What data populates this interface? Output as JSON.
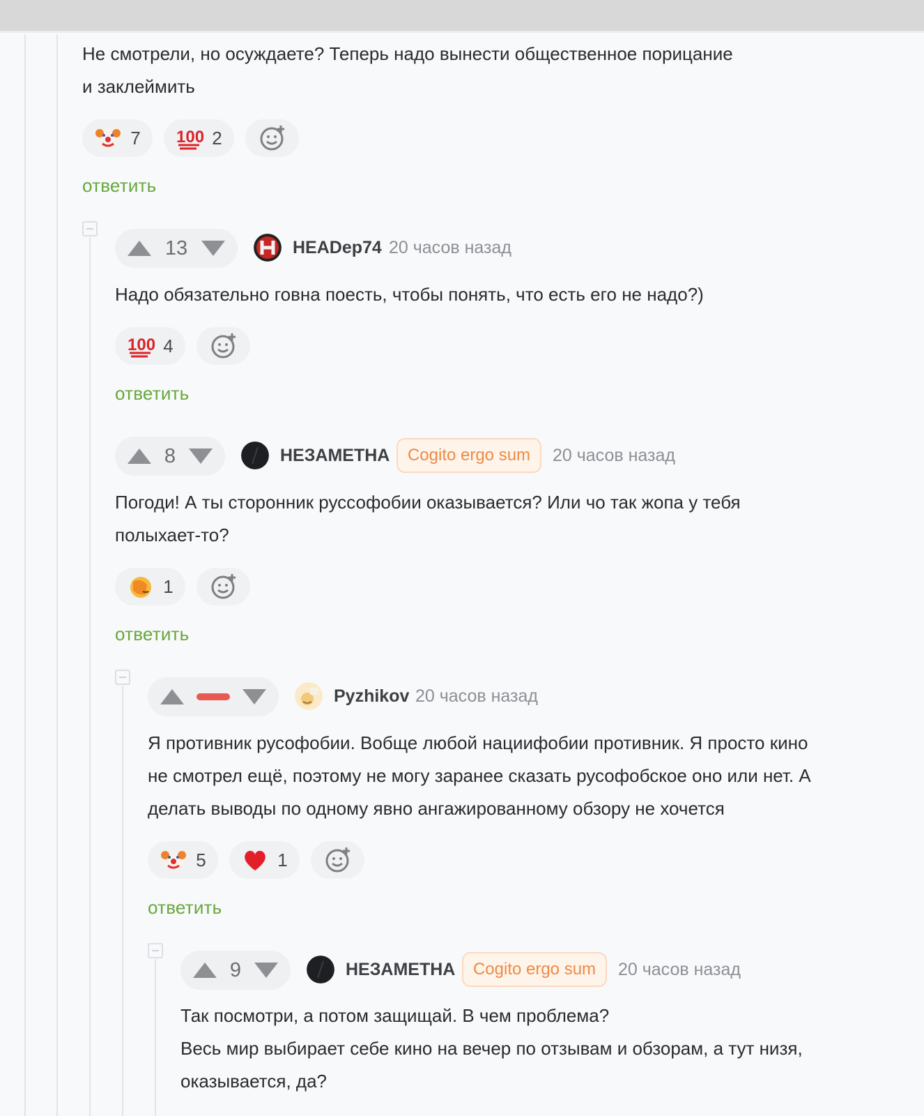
{
  "comments": [
    {
      "text_lines": [
        "Не смотрели, но осуждаете? Теперь надо вынести общественное порицание",
        "и заклеймить"
      ],
      "reactions": [
        {
          "icon": "clown-face-icon",
          "count": "7"
        },
        {
          "icon": "hundred-points-icon",
          "count": "2"
        }
      ],
      "reply_label": "ответить"
    },
    {
      "vote_count": "13",
      "username": "HEADep74",
      "time": "20 часов назад",
      "text_lines": [
        "Надо обязательно говна поесть, чтобы понять, что есть его не надо?)"
      ],
      "reactions": [
        {
          "icon": "hundred-points-icon",
          "count": "4"
        }
      ],
      "reply_label": "ответить"
    },
    {
      "vote_count": "8",
      "username": "НЕЗАМЕТНА",
      "badge": "Cogito ergo sum",
      "time": "20 часов назад",
      "text_lines": [
        "Погоди! А ты сторонник руссофобии оказывается? Или чо так жопа у тебя",
        "полыхает-то?"
      ],
      "reactions": [
        {
          "icon": "facepalm-icon",
          "count": "1"
        }
      ],
      "reply_label": "ответить"
    },
    {
      "username": "Pyzhikov",
      "time": "20 часов назад",
      "text_lines": [
        "Я противник русофобии. Вобще любой нациифобии противник. Я просто кино",
        "не смотрел ещё, поэтому не могу заранее сказать русофобское оно или нет. А",
        "делать выводы по одному явно ангажированному обзору не хочется"
      ],
      "reactions": [
        {
          "icon": "clown-face-icon",
          "count": "5"
        },
        {
          "icon": "red-heart-icon",
          "count": "1"
        }
      ],
      "reply_label": "ответить"
    },
    {
      "vote_count": "9",
      "username": "НЕЗАМЕТНА",
      "badge": "Cogito ergo sum",
      "time": "20 часов назад",
      "text_lines": [
        "Так посмотри, а потом защищай. В чем проблема?",
        "Весь мир выбирает себе кино на вечер по отзывам и обзорам, а тут низя,",
        "оказывается, да?"
      ]
    }
  ],
  "colors": {
    "reply": "#67a73c",
    "negative": "#e85a50",
    "badge_text": "#ee8a45"
  }
}
